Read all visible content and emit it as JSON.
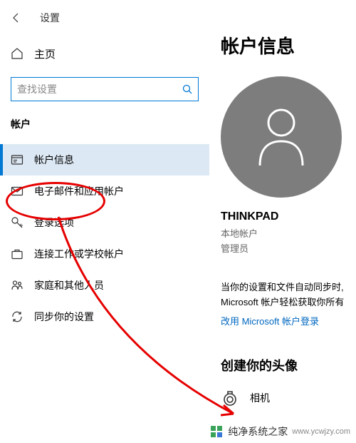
{
  "header": {
    "title": "设置"
  },
  "home": {
    "label": "主页"
  },
  "search": {
    "placeholder": "查找设置"
  },
  "section": {
    "label": "帐户"
  },
  "nav": [
    {
      "label": "帐户信息",
      "active": true
    },
    {
      "label": "电子邮件和应用帐户",
      "active": false
    },
    {
      "label": "登录选项",
      "active": false
    },
    {
      "label": "连接工作或学校帐户",
      "active": false
    },
    {
      "label": "家庭和其他人员",
      "active": false
    },
    {
      "label": "同步你的设置",
      "active": false
    }
  ],
  "main": {
    "title": "帐户信息",
    "username": "THINKPAD",
    "account_type": "本地帐户",
    "account_role": "管理员",
    "sync_line1": "当你的设置和文件自动同步时,",
    "sync_line2": "Microsoft 帐户轻松获取你所有",
    "link": "改用 Microsoft 帐户登录",
    "create_avatar": "创建你的头像",
    "camera": "相机"
  },
  "watermark": {
    "text": "纯净系统之家",
    "url": "www.ycwjzy.com"
  }
}
